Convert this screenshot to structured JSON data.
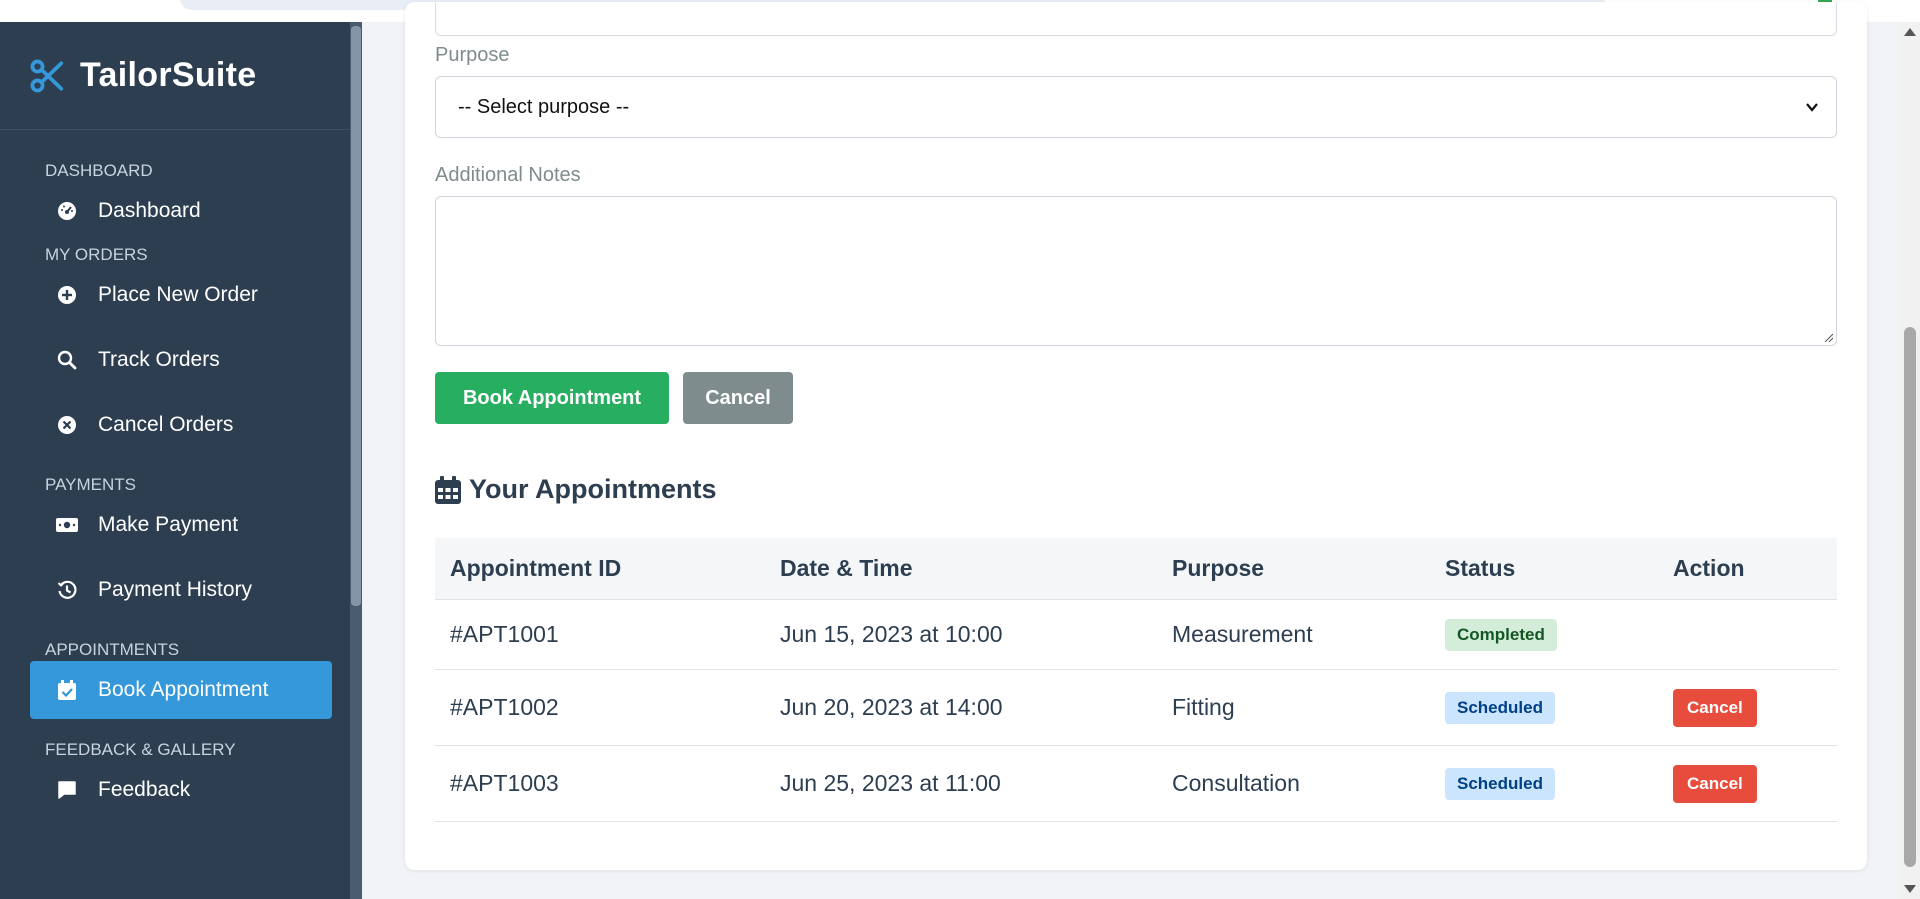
{
  "app": {
    "name": "TailorSuite"
  },
  "sidebar": {
    "sections": [
      {
        "label": "DASHBOARD",
        "items": [
          {
            "label": "Dashboard",
            "icon": "gauge-icon"
          }
        ]
      },
      {
        "label": "MY ORDERS",
        "items": [
          {
            "label": "Place New Order",
            "icon": "plus-circle-icon"
          },
          {
            "label": "Track Orders",
            "icon": "search-icon"
          },
          {
            "label": "Cancel Orders",
            "icon": "x-circle-icon"
          }
        ]
      },
      {
        "label": "PAYMENTS",
        "items": [
          {
            "label": "Make Payment",
            "icon": "money-bill-icon"
          },
          {
            "label": "Payment History",
            "icon": "history-icon"
          }
        ]
      },
      {
        "label": "APPOINTMENTS",
        "items": [
          {
            "label": "Book Appointment",
            "icon": "calendar-check-icon",
            "active": true
          }
        ]
      },
      {
        "label": "FEEDBACK & GALLERY",
        "items": [
          {
            "label": "Feedback",
            "icon": "comment-icon"
          }
        ]
      }
    ]
  },
  "form": {
    "purpose_label": "Purpose",
    "purpose_value": "-- Select purpose --",
    "notes_label": "Additional Notes",
    "book_button": "Book Appointment",
    "cancel_button": "Cancel"
  },
  "appointments": {
    "title": "Your Appointments",
    "columns": [
      "Appointment ID",
      "Date & Time",
      "Purpose",
      "Status",
      "Action"
    ],
    "rows": [
      {
        "id": "#APT1001",
        "datetime": "Jun 15, 2023 at 10:00",
        "purpose": "Measurement",
        "status": "Completed",
        "action": ""
      },
      {
        "id": "#APT1002",
        "datetime": "Jun 20, 2023 at 14:00",
        "purpose": "Fitting",
        "status": "Scheduled",
        "action": "Cancel"
      },
      {
        "id": "#APT1003",
        "datetime": "Jun 25, 2023 at 11:00",
        "purpose": "Consultation",
        "status": "Scheduled",
        "action": "Cancel"
      }
    ]
  },
  "colors": {
    "sidebar_bg": "#2c3e50",
    "active_nav": "#3498db",
    "brand_icon": "#3498db",
    "book_button": "#27ae60",
    "cancel_button": "#7f8c8d",
    "danger": "#e74c3c",
    "completed_badge_bg": "#d4edda",
    "scheduled_badge_bg": "#cce5ff"
  }
}
